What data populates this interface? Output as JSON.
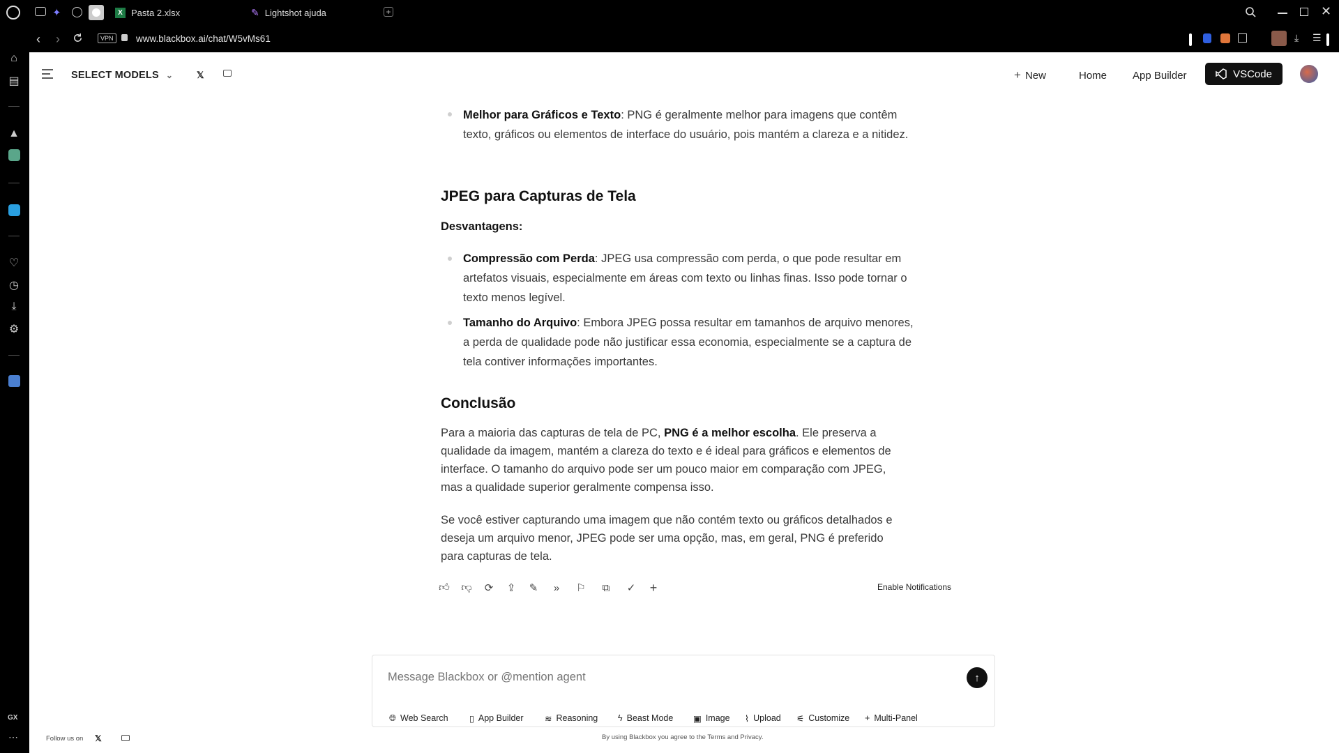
{
  "browser": {
    "tabs": [
      {
        "label": "Pasta 2.xlsx"
      },
      {
        "label": "Lightshot ajuda"
      }
    ],
    "url": "www.blackbox.ai/chat/W5vMs61",
    "vpn_label": "VPN"
  },
  "sidebar": {
    "gx_label": "GX"
  },
  "header": {
    "select_models": "SELECT MODELS",
    "new_label": "New",
    "home_label": "Home",
    "app_builder_label": "App Builder",
    "vscode_label": "VSCode"
  },
  "content": {
    "bullet1_bold": "Melhor para Gráficos e Texto",
    "bullet1_text": ": PNG é geralmente melhor para imagens que contêm texto, gráficos ou elementos de interface do usuário, pois mantém a clareza e a nitidez.",
    "section_jpeg": "JPEG para Capturas de Tela",
    "disadvantages": "Desvantagens:",
    "bullet2_bold": "Compressão com Perda",
    "bullet2_text": ": JPEG usa compressão com perda, o que pode resultar em artefatos visuais, especialmente em áreas com texto ou linhas finas. Isso pode tornar o texto menos legível.",
    "bullet3_bold": "Tamanho do Arquivo",
    "bullet3_text": ": Embora JPEG possa resultar em tamanhos de arquivo menores, a perda de qualidade pode não justificar essa economia, especialmente se a captura de tela contiver informações importantes.",
    "section_conclusion": "Conclusão",
    "para1_pre": "Para a maioria das capturas de tela de PC, ",
    "para1_bold": "PNG é a melhor escolha",
    "para1_post": ". Ele preserva a qualidade da imagem, mantém a clareza do texto e é ideal para gráficos e elementos de interface. O tamanho do arquivo pode ser um pouco maior em comparação com JPEG, mas a qualidade superior geralmente compensa isso.",
    "para2": "Se você estiver capturando uma imagem que não contém texto ou gráficos detalhados e deseja um arquivo menor, JPEG pode ser uma opção, mas, em geral, PNG é preferido para capturas de tela."
  },
  "actions": {
    "enable_notifications": "Enable Notifications"
  },
  "composer": {
    "placeholder": "Message Blackbox or @mention agent",
    "tools": [
      "Web Search",
      "App Builder",
      "Reasoning",
      "Beast Mode",
      "Image",
      "Upload",
      "Customize",
      "Multi-Panel"
    ]
  },
  "footer": {
    "follow_us": "Follow us on",
    "disclaimer": "By using Blackbox you agree to the Terms and Privacy."
  },
  "colors": {
    "vscode_bg": "#111111",
    "page_bg": "#ffffff",
    "chrome_bg": "#000000"
  }
}
